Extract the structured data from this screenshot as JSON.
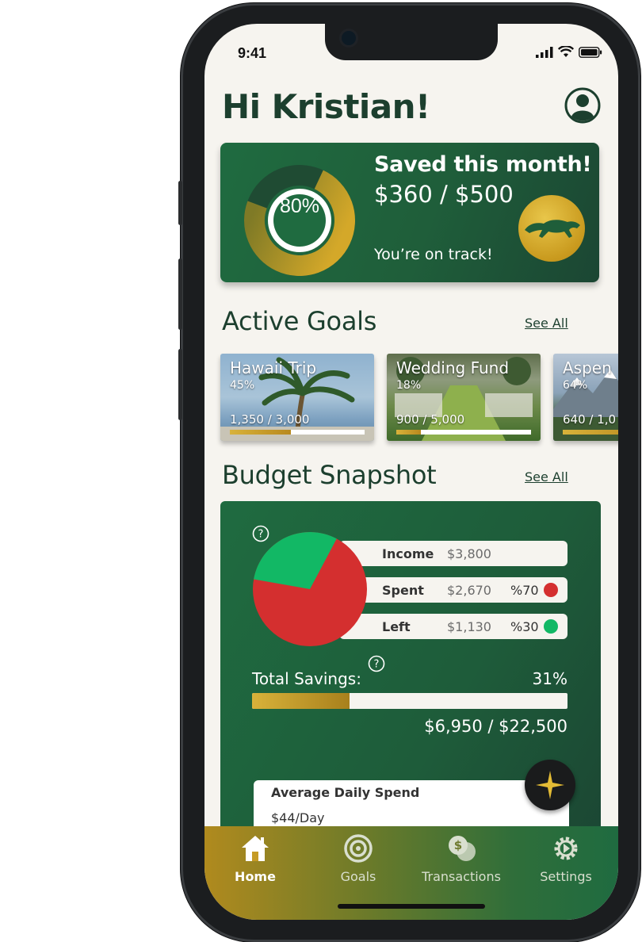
{
  "status": {
    "time": "9:41"
  },
  "greeting": "Hi Kristian!",
  "saved": {
    "ring_label": "80%",
    "progress_pct": 80,
    "title": "Saved this month!",
    "amount": "$360 / $500",
    "status": "You’re on track!"
  },
  "active_goals": {
    "title": "Active Goals",
    "see_all": "See All",
    "goals": [
      {
        "name": "Hawaii Trip",
        "pct": "45%",
        "amount": "1,350 / 3,000",
        "progress": 45
      },
      {
        "name": "Wedding Fund",
        "pct": "18%",
        "amount": "900 / 5,000",
        "progress": 18
      },
      {
        "name": "Aspen",
        "pct": "64%",
        "amount": "640 / 1,0",
        "progress": 64
      }
    ]
  },
  "budget": {
    "title": "Budget Snapshot",
    "see_all": "See All",
    "rows": [
      {
        "label": "Income",
        "value": "$3,800",
        "pct": ""
      },
      {
        "label": "Spent",
        "value": "$2,670",
        "pct": "%70",
        "color": "#d42f2f"
      },
      {
        "label": "Left",
        "value": "$1,130",
        "pct": "%30",
        "color": "#12b865"
      }
    ],
    "total_savings_label": "Total Savings:",
    "total_savings_pct": "31%",
    "total_savings_progress": 31,
    "total_savings_amount": "$6,950 / $22,500",
    "avg_daily_title": "Average Daily Spend",
    "avg_daily_value": "$44/Day"
  },
  "nav": {
    "items": [
      {
        "label": "Home",
        "icon": "home-icon"
      },
      {
        "label": "Goals",
        "icon": "target-icon"
      },
      {
        "label": "Transactions",
        "icon": "coins-icon"
      },
      {
        "label": "Settings",
        "icon": "gear-icon"
      }
    ]
  },
  "colors": {
    "brand_green": "#1f6b40",
    "gold": "#c99a1e",
    "spent_red": "#d42f2f",
    "left_green": "#12b865"
  }
}
